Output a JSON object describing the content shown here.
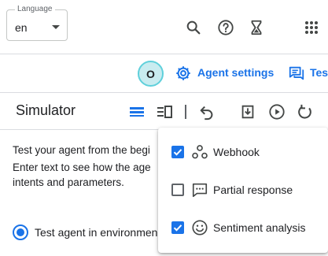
{
  "header": {
    "language_label": "Language",
    "language_value": "en"
  },
  "toolbar": {
    "badge_letter": "O",
    "agent_settings_label": "Agent settings",
    "test_label": "Tes"
  },
  "simulator": {
    "title": "Simulator",
    "description_lines": [
      "Test your agent from the begi",
      "Enter text to see how the age",
      "intents and parameters."
    ],
    "radio_label": "Test agent in environmen"
  },
  "menu": {
    "items": [
      {
        "label": "Webhook",
        "checked": true,
        "icon": "webhook-icon"
      },
      {
        "label": "Partial response",
        "checked": false,
        "icon": "chat-bubble-icon"
      },
      {
        "label": "Sentiment analysis",
        "checked": true,
        "icon": "smiley-icon"
      }
    ]
  },
  "colors": {
    "accent": "#1a73e8",
    "badge_bg": "#c9ecf0",
    "badge_border": "#5fd0db"
  }
}
